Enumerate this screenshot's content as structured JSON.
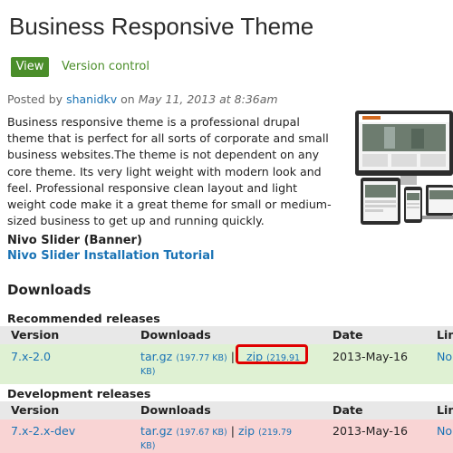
{
  "page": {
    "title": "Business Responsive Theme",
    "tabs": {
      "view": "View",
      "version_control": "Version control"
    },
    "meta": {
      "posted_by": "Posted by",
      "author": "shanidkv",
      "on": "on",
      "date": "May 11, 2013 at 8:36am"
    },
    "description": "Business responsive theme is a professional drupal theme that is perfect for all sorts of corporate and small business websites.The theme is not dependent on any core theme. Its very light weight with modern look and feel. Professional responsive clean layout and light weight code make it a great theme for small or medium-sized business to get up and running quickly.",
    "nivo_heading": "Nivo Slider (Banner)",
    "nivo_link": "Nivo Slider Installation Tutorial",
    "downloads_heading": "Downloads"
  },
  "recommended": {
    "heading": "Recommended releases",
    "columns": {
      "version": "Version",
      "downloads": "Downloads",
      "date": "Date",
      "links": "Lin"
    },
    "row": {
      "version": "7.x-2.0",
      "targz": "tar.gz",
      "targz_size": "(197.77 KB)",
      "sep": "|",
      "zip": "zip",
      "zip_size": "(219.91",
      "zip_size_cont": "KB)",
      "date": "2013-May-16",
      "link": "No"
    }
  },
  "development": {
    "heading": "Development releases",
    "columns": {
      "version": "Version",
      "downloads": "Downloads",
      "date": "Date",
      "links": "Lin"
    },
    "row": {
      "version": "7.x-2.x-dev",
      "targz": "tar.gz",
      "targz_size": "(197.67 KB)",
      "sep": "|",
      "zip": "zip",
      "zip_size": "(219.79",
      "zip_size_cont": "KB)",
      "date": "2013-May-16",
      "link": "No"
    }
  },
  "colors": {
    "accent_green": "#4b8e2a",
    "link_blue": "#1a73b5",
    "highlight_red": "#e00000"
  }
}
